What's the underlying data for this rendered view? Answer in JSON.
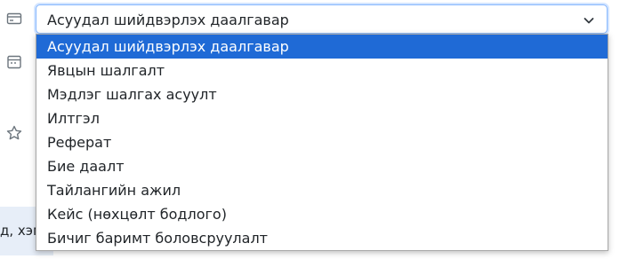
{
  "left_rail": {
    "icons": [
      "card-icon",
      "calendar-icon",
      "star-icon"
    ]
  },
  "info_banner": {
    "text": "д, хэм"
  },
  "task_type_select": {
    "selected_label": "Асуудал шийдвэрлэх даалгавар",
    "options": [
      "Асуудал шийдвэрлэх даалгавар",
      "Явцын шалгалт",
      "Мэдлэг шалгах асуулт",
      "Илтгэл",
      "Реферат",
      "Бие даалт",
      "Тайлангийн ажил",
      "Кейс (нөхцөлт бодлого)",
      "Бичиг баримт боловсруулалт"
    ],
    "selected_index": 0
  },
  "colors": {
    "selected_option_bg": "#1f6ad6",
    "focus_border": "#86b7fe",
    "banner_bg": "#e7eef8"
  }
}
